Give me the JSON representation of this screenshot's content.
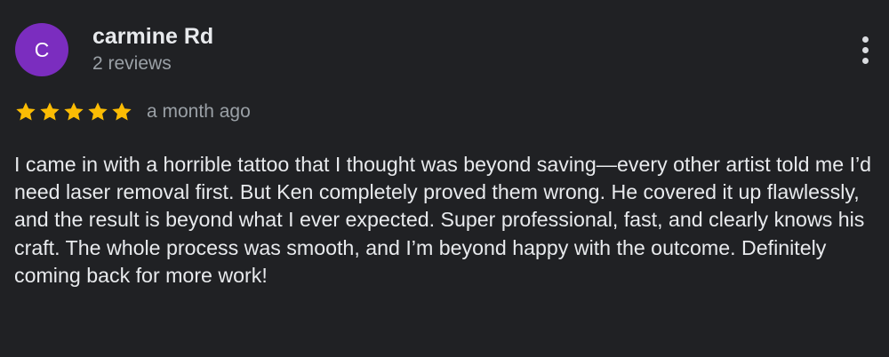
{
  "review": {
    "author": {
      "initial": "C",
      "avatar_color": "#7b2dbf",
      "name": "carmine Rd",
      "reviews_count": "2 reviews"
    },
    "menu_icon": "more-vert-icon",
    "rating": {
      "stars": 5,
      "max_stars": 5,
      "star_color": "#fbbc04",
      "star_icon": "star-icon"
    },
    "time_ago": "a month ago",
    "text": "I came in with a horrible tattoo that I thought was beyond saving—every other artist told me I’d need laser removal first. But Ken completely proved them wrong. He covered it up flawlessly, and the result is beyond what I ever expected. Super professional, fast, and clearly knows his craft. The whole process was smooth, and I’m beyond happy with the outcome. Definitely coming back for more work!"
  },
  "theme": {
    "background": "#202124",
    "primary_text": "#e8eaed",
    "secondary_text": "#9aa0a6"
  }
}
